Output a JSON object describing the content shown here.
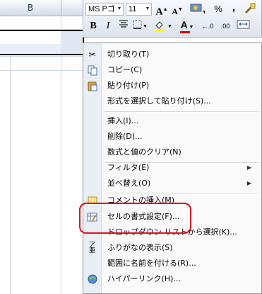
{
  "sheet": {
    "column_b": "B"
  },
  "mini_toolbar": {
    "font_name": "MS Pゴ",
    "font_size": "11",
    "grow_font": "A",
    "shrink_font": "A",
    "percent": "%",
    "comma": ",",
    "bold": "B",
    "italic": "I",
    "font_color": "A",
    "inc_decimal": "←.0",
    "dec_decimal": ".00"
  },
  "menu": {
    "items": [
      {
        "label": "切り取り(T)",
        "icon": "scissors-icon"
      },
      {
        "label": "コピー(C)",
        "icon": "copy-icon"
      },
      {
        "label": "貼り付け(P)",
        "icon": "paste-icon"
      },
      {
        "label": "形式を選択して貼り付け(S)..."
      },
      {
        "label": "挿入(I)..."
      },
      {
        "label": "削除(D)..."
      },
      {
        "label": "数式と値のクリア(N)"
      },
      {
        "label": "フィルタ(E)",
        "submenu": true
      },
      {
        "label": "並べ替え(O)",
        "submenu": true
      },
      {
        "label": "コメントの挿入(M)",
        "icon": "comment-icon"
      },
      {
        "label": "セルの書式設定(F)...",
        "icon": "format-cells-icon"
      },
      {
        "label": "ドロップダウン リストから選択(K)..."
      },
      {
        "label": "ふりがなの表示(S)",
        "icon": "furigana-icon"
      },
      {
        "label": "範囲に名前を付ける(R)..."
      },
      {
        "label": "ハイパーリンク(H)...",
        "icon": "hyperlink-icon"
      }
    ],
    "submenu_arrow": "▶"
  },
  "colors": {
    "highlight": "#e4101a",
    "menu_bg": "#fafafa",
    "gutter": "#e9eef5"
  }
}
